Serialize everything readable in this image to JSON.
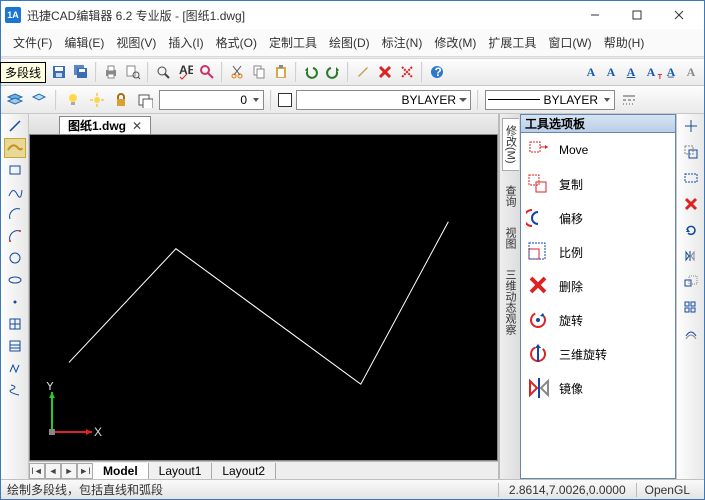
{
  "title": "迅捷CAD编辑器 6.2 专业版  -  [图纸1.dwg]",
  "menu": [
    "文件(F)",
    "编辑(E)",
    "视图(V)",
    "插入(I)",
    "格式(O)",
    "定制工具",
    "绘图(D)",
    "标注(N)",
    "修改(M)",
    "扩展工具",
    "窗口(W)",
    "帮助(H)"
  ],
  "layerCombo": "0",
  "bylayer": "BYLAYER",
  "docTab": "图纸1.dwg",
  "tooltip": "多段线",
  "layoutTabs": [
    "Model",
    "Layout1",
    "Layout2"
  ],
  "palette": {
    "title": "工具选项板",
    "vtabs": [
      "修改(M)",
      "查询",
      "视图",
      "三维动态观察"
    ],
    "items": [
      {
        "label": "Move",
        "icon": "move"
      },
      {
        "label": "复制",
        "icon": "copy"
      },
      {
        "label": "偏移",
        "icon": "offset"
      },
      {
        "label": "比例",
        "icon": "scale"
      },
      {
        "label": "删除",
        "icon": "delete"
      },
      {
        "label": "旋转",
        "icon": "rotate"
      },
      {
        "label": "三维旋转",
        "icon": "rotate3d"
      },
      {
        "label": "镜像",
        "icon": "mirror"
      }
    ]
  },
  "status": {
    "hint": "绘制多段线，包括直线和弧段",
    "coord": "2.8614,7.0026,0.0000",
    "renderer": "OpenGL"
  },
  "ucs": {
    "x": "X",
    "y": "Y"
  }
}
